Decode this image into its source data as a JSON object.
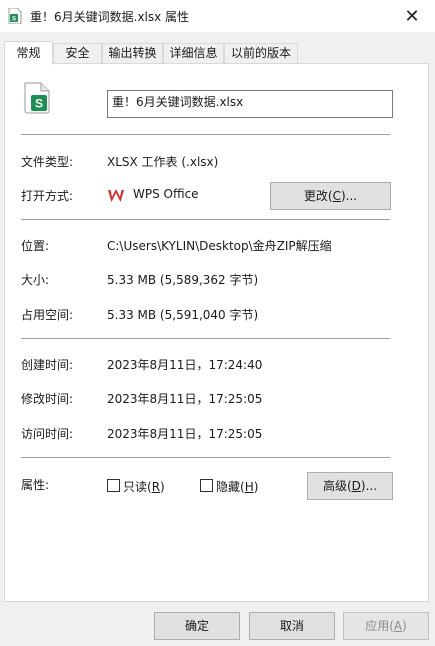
{
  "window": {
    "title": "重！6月关键词数据.xlsx 属性",
    "close_glyph": "✕"
  },
  "tabs": [
    "常规",
    "安全",
    "输出转换",
    "详细信息",
    "以前的版本"
  ],
  "file": {
    "name": "重！6月关键词数据.xlsx",
    "icon": "sheets-file-icon",
    "icon_letter": "S"
  },
  "type_row": {
    "label": "文件类型:",
    "value": "XLSX 工作表 (.xlsx)"
  },
  "open_with": {
    "label": "打开方式:",
    "app": "WPS Office",
    "icon": "wps-logo-icon",
    "change_button": {
      "pre": "更改(",
      "key": "C",
      "post": ")..."
    }
  },
  "location": {
    "label": "位置:",
    "value": "C:\\Users\\KYLIN\\Desktop\\金舟ZIP解压缩"
  },
  "size": {
    "label": "大小:",
    "value": "5.33 MB (5,589,362 字节)"
  },
  "size_on_disk": {
    "label": "占用空间:",
    "value": "5.33 MB (5,591,040 字节)"
  },
  "created": {
    "label": "创建时间:",
    "value": "2023年8月11日，17:24:40"
  },
  "modified": {
    "label": "修改时间:",
    "value": "2023年8月11日，17:25:05"
  },
  "accessed": {
    "label": "访问时间:",
    "value": "2023年8月11日，17:25:05"
  },
  "attributes": {
    "label": "属性:",
    "readonly": {
      "pre": "只读(",
      "key": "R",
      "post": ")",
      "checked": false
    },
    "hidden": {
      "pre": "隐藏(",
      "key": "H",
      "post": ")",
      "checked": false
    },
    "advanced_button": {
      "pre": "高级(",
      "key": "D",
      "post": ")..."
    }
  },
  "footer": {
    "ok": "确定",
    "cancel": "取消",
    "apply": {
      "pre": "应用(",
      "key": "A",
      "post": ")",
      "enabled": false
    }
  },
  "colors": {
    "sheets_green": "#1d8f55",
    "wps_red": "#d62b2b",
    "accent": "#0078d7"
  }
}
